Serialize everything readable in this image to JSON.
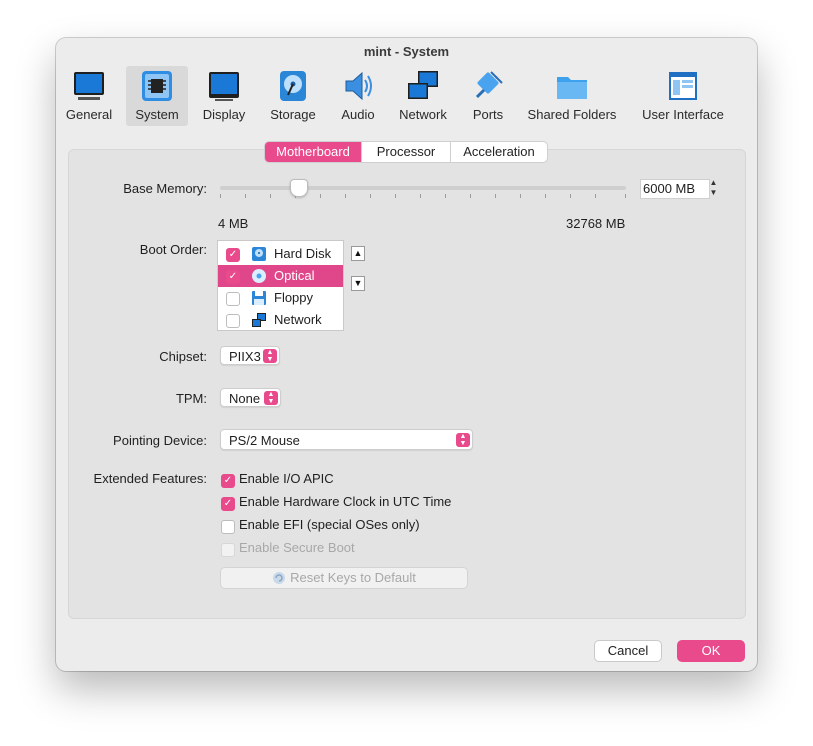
{
  "window": {
    "title": "mint - System"
  },
  "toolbar": {
    "items": [
      {
        "label": "General",
        "icon": "monitor-icon"
      },
      {
        "label": "System",
        "icon": "chip-icon",
        "selected": true
      },
      {
        "label": "Display",
        "icon": "display-icon"
      },
      {
        "label": "Storage",
        "icon": "disk-icon"
      },
      {
        "label": "Audio",
        "icon": "speaker-icon"
      },
      {
        "label": "Network",
        "icon": "network-icon"
      },
      {
        "label": "Ports",
        "icon": "plug-icon"
      },
      {
        "label": "Shared Folders",
        "icon": "folder-icon"
      },
      {
        "label": "User Interface",
        "icon": "window-icon"
      }
    ]
  },
  "tabs": [
    {
      "label": "Motherboard",
      "selected": true
    },
    {
      "label": "Processor"
    },
    {
      "label": "Acceleration"
    }
  ],
  "base_memory": {
    "label": "Base Memory:",
    "value": "6000 MB",
    "value_mb": 6000,
    "min_label": "4 MB",
    "max_label": "32768 MB"
  },
  "boot_order": {
    "label": "Boot Order:",
    "items": [
      {
        "label": "Hard Disk",
        "checked": true,
        "icon": "hard-disk-icon"
      },
      {
        "label": "Optical",
        "checked": true,
        "selected": true,
        "icon": "optical-disc-icon"
      },
      {
        "label": "Floppy",
        "checked": false,
        "icon": "floppy-icon"
      },
      {
        "label": "Network",
        "checked": false,
        "icon": "network-icon"
      }
    ]
  },
  "chipset": {
    "label": "Chipset:",
    "value": "PIIX3"
  },
  "tpm": {
    "label": "TPM:",
    "value": "None"
  },
  "pointing_device": {
    "label": "Pointing Device:",
    "value": "PS/2 Mouse"
  },
  "extended_features": {
    "label": "Extended Features:",
    "options": [
      {
        "label": "Enable I/O APIC",
        "checked": true,
        "enabled": true
      },
      {
        "label": "Enable Hardware Clock in UTC Time",
        "checked": true,
        "enabled": true
      },
      {
        "label": "Enable EFI (special OSes only)",
        "checked": false,
        "enabled": true
      },
      {
        "label": "Enable Secure Boot",
        "checked": false,
        "enabled": false
      }
    ],
    "reset_button": "Reset Keys to Default"
  },
  "buttons": {
    "cancel": "Cancel",
    "ok": "OK"
  },
  "colors": {
    "accent": "#e84a8c",
    "selected_row": "#e0478a"
  }
}
